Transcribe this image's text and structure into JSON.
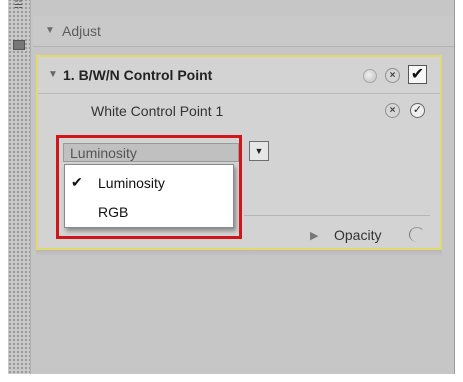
{
  "panel": {
    "section_title": "Adjust",
    "control_point": {
      "title": "1. B/W/N Control Point",
      "checked": true
    },
    "sub_point": {
      "label": "White Control Point 1"
    },
    "mode_select": {
      "value": "Luminosity",
      "options": [
        {
          "label": "Luminosity",
          "selected": true
        },
        {
          "label": "RGB",
          "selected": false
        }
      ]
    },
    "opacity": {
      "label": "Opacity"
    }
  },
  "colors": {
    "highlight_border": "#d0161b",
    "panel_border": "#e4d870",
    "background": "#c6c6c6"
  },
  "icons": {
    "checkmark": "✔",
    "close": "×",
    "triangle_down": "▼",
    "triangle_right": "▶"
  }
}
